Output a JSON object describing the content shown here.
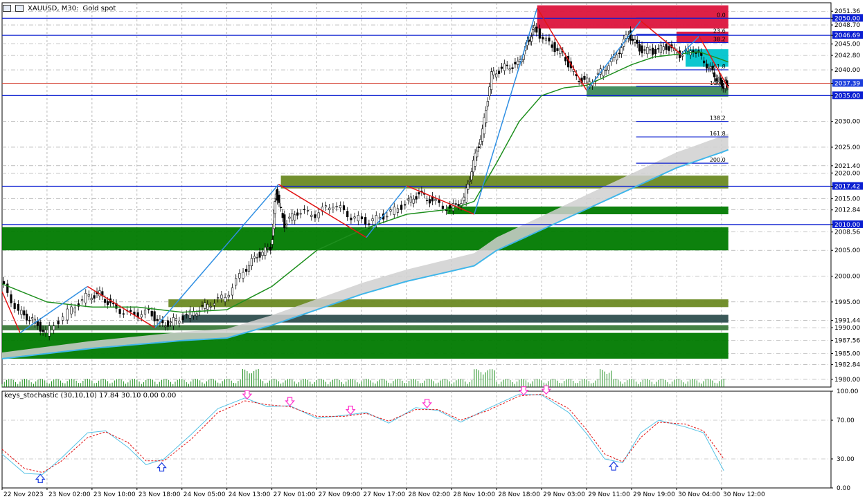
{
  "header": {
    "symbol": "XAUUSD, M30:",
    "description": "Gold spot",
    "icons": [
      "chart-menu-icon",
      "one-click-trading-icon"
    ]
  },
  "indicator": {
    "title": "keys_stochastic (30,10,10) 17.84 30.10 0.00 0.00"
  },
  "colors": {
    "background": "#ffffff",
    "grid": "#9a9a9a",
    "bull_candle": "#000000",
    "bear_candle": "#000000",
    "ma_fast": "#1e8f1e",
    "ma_slow": "#3fb6ea",
    "cloud": "#d0d0d0",
    "zigzag_up": "#2f8fe3",
    "zigzag_down": "#e31515",
    "level_line": "#0b1fd1",
    "zone_green": "#007a00",
    "zone_olive": "#6b8a23",
    "zone_dark": "#2f4f4f",
    "zone_red": "#dc143c",
    "zone_cyan": "#00c4cc",
    "stoch_main": "#56c3e6",
    "stoch_signal": "#e31515",
    "arrow_down": "#ff33cc",
    "arrow_up": "#1f3fe0"
  },
  "chart_data": [
    {
      "type": "candlestick",
      "symbol": "XAUUSD",
      "timeframe": "M30",
      "ylim": [
        1978.5,
        2053.0
      ],
      "y_ticks": [
        2051.36,
        2050.0,
        2048.7,
        2046.69,
        2045.0,
        2042.8,
        2040.0,
        2037.39,
        2035.0,
        2030.0,
        2025.0,
        2021.4,
        2020.0,
        2017.42,
        2015.0,
        2012.84,
        2010.0,
        2008.56,
        2005.0,
        2000.0,
        1995.0,
        1991.44,
        1990.0,
        1987.56,
        1985.0,
        1982.84,
        1980.0
      ],
      "highlighted_prices": [
        {
          "label": "2050.00",
          "kind": "level"
        },
        {
          "label": "2046.69",
          "kind": "level"
        },
        {
          "label": "2037.39",
          "kind": "current"
        },
        {
          "label": "2035.00",
          "kind": "level"
        },
        {
          "label": "2017.42",
          "kind": "level"
        },
        {
          "label": "2010.00",
          "kind": "level"
        }
      ],
      "x_ticks": [
        "22 Nov 2023",
        "23 Nov 02:00",
        "23 Nov 10:00",
        "23 Nov 18:00",
        "24 Nov 05:00",
        "24 Nov 13:00",
        "27 Nov 01:00",
        "27 Nov 09:00",
        "27 Nov 17:00",
        "28 Nov 02:00",
        "28 Nov 10:00",
        "28 Nov 18:00",
        "29 Nov 03:00",
        "29 Nov 11:00",
        "29 Nov 19:00",
        "30 Nov 04:00",
        "30 Nov 12:00"
      ],
      "close_path": [
        [
          0,
          1999.0
        ],
        [
          0.4,
          1993.0
        ],
        [
          0.7,
          1991.5
        ],
        [
          1.0,
          1989.0
        ],
        [
          1.5,
          1993.0
        ],
        [
          1.9,
          1996.0
        ],
        [
          2.2,
          1996.5
        ],
        [
          2.5,
          1994.0
        ],
        [
          2.9,
          1992.5
        ],
        [
          3.3,
          1993.0
        ],
        [
          3.6,
          1990.5
        ],
        [
          3.9,
          1991.5
        ],
        [
          4.3,
          1993.0
        ],
        [
          4.6,
          1994.5
        ],
        [
          5.0,
          1996.0
        ],
        [
          5.4,
          2001.0
        ],
        [
          5.7,
          2004.0
        ],
        [
          6.0,
          2005.5
        ],
        [
          6.1,
          2016.5
        ],
        [
          6.3,
          2010.0
        ],
        [
          6.6,
          2012.5
        ],
        [
          7.0,
          2012.0
        ],
        [
          7.4,
          2014.0
        ],
        [
          7.8,
          2011.5
        ],
        [
          8.2,
          2010.5
        ],
        [
          8.6,
          2012.0
        ],
        [
          9.0,
          2014.0
        ],
        [
          9.3,
          2016.0
        ],
        [
          9.6,
          2014.5
        ],
        [
          10.0,
          2013.0
        ],
        [
          10.3,
          2015.0
        ],
        [
          10.5,
          2022.0
        ],
        [
          10.7,
          2028.0
        ],
        [
          10.9,
          2039.0
        ],
        [
          11.2,
          2040.5
        ],
        [
          11.5,
          2041.0
        ],
        [
          11.7,
          2045.0
        ],
        [
          11.85,
          2048.0
        ],
        [
          12.2,
          2045.0
        ],
        [
          12.5,
          2043.0
        ],
        [
          12.8,
          2038.5
        ],
        [
          13.1,
          2037.5
        ],
        [
          13.4,
          2040.0
        ],
        [
          13.7,
          2043.0
        ],
        [
          13.95,
          2047.0
        ],
        [
          14.2,
          2044.0
        ],
        [
          14.5,
          2043.5
        ],
        [
          14.8,
          2044.5
        ],
        [
          15.1,
          2043.0
        ],
        [
          15.4,
          2044.0
        ],
        [
          15.7,
          2041.0
        ],
        [
          15.9,
          2038.5
        ],
        [
          16.05,
          2037.0
        ],
        [
          16.15,
          2037.4
        ]
      ],
      "ma_fast_path": [
        [
          0,
          1998.5
        ],
        [
          1.0,
          1995.0
        ],
        [
          2.0,
          1994.0
        ],
        [
          3.0,
          1994.0
        ],
        [
          4.0,
          1993.0
        ],
        [
          5.0,
          1993.5
        ],
        [
          6.0,
          1998.0
        ],
        [
          7.0,
          2005.0
        ],
        [
          8.0,
          2009.0
        ],
        [
          9.0,
          2012.0
        ],
        [
          10.0,
          2013.0
        ],
        [
          10.5,
          2014.5
        ],
        [
          11.0,
          2022.0
        ],
        [
          11.5,
          2030.0
        ],
        [
          12.0,
          2035.0
        ],
        [
          12.5,
          2036.5
        ],
        [
          13.0,
          2037.0
        ],
        [
          13.5,
          2039.0
        ],
        [
          14.0,
          2041.0
        ],
        [
          14.5,
          2042.5
        ],
        [
          15.0,
          2043.0
        ],
        [
          15.5,
          2043.5
        ],
        [
          16.0,
          2042.0
        ],
        [
          16.15,
          2041.5
        ]
      ],
      "ma_slow_path": [
        [
          0,
          1984.0
        ],
        [
          2.0,
          1986.0
        ],
        [
          4.0,
          1987.5
        ],
        [
          5.0,
          1988.0
        ],
        [
          6.0,
          1990.5
        ],
        [
          7.0,
          1993.5
        ],
        [
          8.0,
          1996.5
        ],
        [
          9.0,
          1999.0
        ],
        [
          10.0,
          2001.0
        ],
        [
          10.5,
          2002.0
        ],
        [
          11.0,
          2005.0
        ],
        [
          12.0,
          2009.0
        ],
        [
          13.0,
          2013.0
        ],
        [
          14.0,
          2017.0
        ],
        [
          15.0,
          2021.0
        ],
        [
          16.0,
          2024.0
        ],
        [
          16.15,
          2024.5
        ]
      ],
      "fib_levels": [
        {
          "label": "0.0",
          "value": 2050.0
        },
        {
          "label": "23.6",
          "value": 2046.9
        },
        {
          "label": "38.2",
          "value": 2045.3
        },
        {
          "label": "61.8",
          "value": 2040.0
        },
        {
          "label": "100.0",
          "value": 2036.8
        },
        {
          "label": "138.2",
          "value": 2030.0
        },
        {
          "label": "161.8",
          "value": 2027.0
        },
        {
          "label": "200.0",
          "value": 2021.9
        }
      ],
      "zones": [
        {
          "x0": 0,
          "x1": 16.15,
          "y0": 1984.0,
          "y1": 1989.0,
          "color": "#007a00"
        },
        {
          "x0": 0,
          "x1": 16.15,
          "y0": 1989.5,
          "y1": 1990.5,
          "color": "#3a7a3a"
        },
        {
          "x0": 4.0,
          "x1": 16.15,
          "y0": 1991.0,
          "y1": 1992.5,
          "color": "#2f4f4f"
        },
        {
          "x0": 3.7,
          "x1": 16.15,
          "y0": 1994.0,
          "y1": 1995.5,
          "color": "#6b8a23"
        },
        {
          "x0": 0,
          "x1": 16.15,
          "y0": 2005.0,
          "y1": 2009.5,
          "color": "#007a00"
        },
        {
          "x0": 9.9,
          "x1": 16.15,
          "y0": 2012.0,
          "y1": 2013.5,
          "color": "#007a00"
        },
        {
          "x0": 6.2,
          "x1": 16.15,
          "y0": 2017.0,
          "y1": 2019.5,
          "color": "#6b8a23"
        },
        {
          "x0": 13.0,
          "x1": 16.15,
          "y0": 2034.8,
          "y1": 2036.8,
          "color": "#3c8a5a"
        },
        {
          "x0": 15.2,
          "x1": 16.15,
          "y0": 2040.6,
          "y1": 2044.0,
          "color": "#00c4cc"
        },
        {
          "x0": 15.0,
          "x1": 16.15,
          "y0": 2045.3,
          "y1": 2047.4,
          "color": "#dc143c"
        },
        {
          "x0": 11.9,
          "x1": 16.15,
          "y0": 2048.0,
          "y1": 2052.5,
          "color": "#dc143c"
        }
      ],
      "zigzag": [
        [
          0,
          1997.0
        ],
        [
          0.4,
          1989.0
        ],
        [
          1.9,
          1998.0
        ],
        [
          3.4,
          1990.0
        ],
        [
          6.15,
          2017.8
        ],
        [
          8.1,
          2007.5
        ],
        [
          9.0,
          2017.5
        ],
        [
          10.5,
          2012.0
        ],
        [
          11.9,
          2052.0
        ],
        [
          13.0,
          2036.0
        ],
        [
          14.2,
          2049.5
        ],
        [
          15.1,
          2043.0
        ],
        [
          15.5,
          2046.5
        ],
        [
          16.15,
          2036.5
        ]
      ]
    },
    {
      "type": "line",
      "title": "keys_stochastic (30,10,10) 17.84 30.10 0.00 0.00",
      "ylim": [
        0,
        100
      ],
      "y_ticks": [
        100.0,
        70.0,
        30.0,
        0.0
      ],
      "series": [
        {
          "role": "main",
          "points": [
            [
              0,
              35
            ],
            [
              0.5,
              15
            ],
            [
              0.9,
              14
            ],
            [
              1.3,
              30
            ],
            [
              1.9,
              57
            ],
            [
              2.3,
              59
            ],
            [
              2.8,
              42
            ],
            [
              3.2,
              24
            ],
            [
              3.6,
              30
            ],
            [
              4.2,
              55
            ],
            [
              4.8,
              82
            ],
            [
              5.4,
              93
            ],
            [
              5.9,
              84
            ],
            [
              6.4,
              85
            ],
            [
              7.0,
              72
            ],
            [
              7.6,
              75
            ],
            [
              8.1,
              78
            ],
            [
              8.6,
              67
            ],
            [
              9.2,
              83
            ],
            [
              9.7,
              80
            ],
            [
              10.2,
              68
            ],
            [
              10.8,
              82
            ],
            [
              11.5,
              97
            ],
            [
              12.0,
              96
            ],
            [
              12.6,
              78
            ],
            [
              13.0,
              56
            ],
            [
              13.4,
              30
            ],
            [
              13.8,
              26
            ],
            [
              14.2,
              57
            ],
            [
              14.6,
              70
            ],
            [
              15.2,
              63
            ],
            [
              15.6,
              57
            ],
            [
              16.05,
              17.84
            ]
          ]
        },
        {
          "role": "signal",
          "points": [
            [
              0,
              40
            ],
            [
              0.5,
              20
            ],
            [
              0.9,
              16
            ],
            [
              1.3,
              27
            ],
            [
              1.9,
              52
            ],
            [
              2.3,
              58
            ],
            [
              2.8,
              47
            ],
            [
              3.2,
              28
            ],
            [
              3.6,
              28
            ],
            [
              4.2,
              50
            ],
            [
              4.8,
              78
            ],
            [
              5.4,
              90
            ],
            [
              5.9,
              86
            ],
            [
              6.4,
              84
            ],
            [
              7.0,
              74
            ],
            [
              7.6,
              74
            ],
            [
              8.1,
              77
            ],
            [
              8.6,
              69
            ],
            [
              9.2,
              81
            ],
            [
              9.7,
              81
            ],
            [
              10.2,
              70
            ],
            [
              10.8,
              80
            ],
            [
              11.5,
              95
            ],
            [
              12.0,
              97
            ],
            [
              12.6,
              82
            ],
            [
              13.0,
              60
            ],
            [
              13.4,
              35
            ],
            [
              13.8,
              27
            ],
            [
              14.2,
              52
            ],
            [
              14.6,
              68
            ],
            [
              15.2,
              66
            ],
            [
              15.6,
              59
            ],
            [
              16.05,
              30.1
            ]
          ]
        }
      ],
      "markers": [
        {
          "kind": "up",
          "x": 0.85,
          "value": 14
        },
        {
          "kind": "up",
          "x": 3.55,
          "value": 26
        },
        {
          "kind": "down",
          "x": 5.45,
          "value": 92
        },
        {
          "kind": "down",
          "x": 6.4,
          "value": 85
        },
        {
          "kind": "down",
          "x": 7.75,
          "value": 76
        },
        {
          "kind": "down",
          "x": 9.45,
          "value": 83
        },
        {
          "kind": "down",
          "x": 11.6,
          "value": 96
        },
        {
          "kind": "down",
          "x": 12.1,
          "value": 97
        },
        {
          "kind": "up",
          "x": 13.6,
          "value": 27
        }
      ]
    }
  ]
}
